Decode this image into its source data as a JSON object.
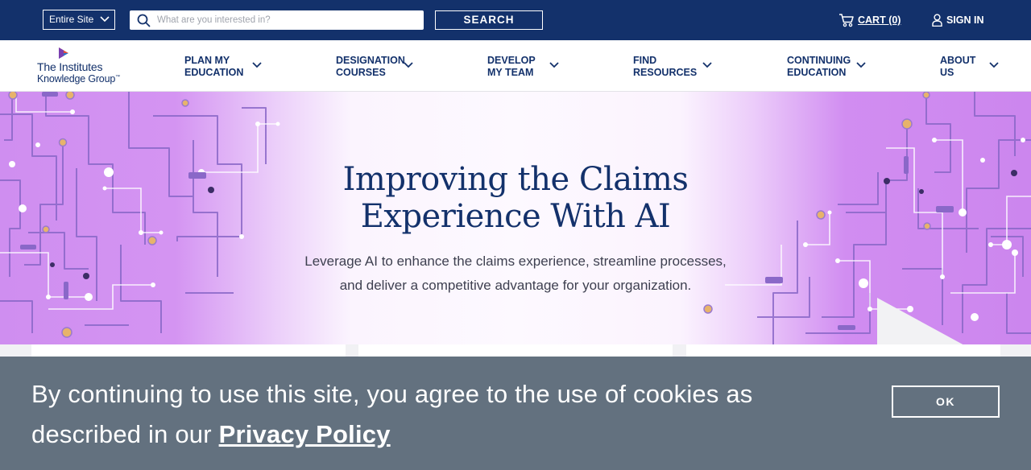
{
  "topbar": {
    "site_select": "Entire Site",
    "search_placeholder": "What are you interested in?",
    "search_button": "SEARCH",
    "cart_label": "CART (0)",
    "signin_label": "SIGN IN"
  },
  "logo": {
    "line1": "The Institutes",
    "line2": "Knowledge Group",
    "trademark": "™"
  },
  "nav": {
    "items": [
      {
        "label": "PLAN MY\nEDUCATION"
      },
      {
        "label": "DESIGNATION\nCOURSES"
      },
      {
        "label": "DEVELOP\nMY TEAM"
      },
      {
        "label": "FIND\nRESOURCES"
      },
      {
        "label": "CONTINUING\nEDUCATION"
      },
      {
        "label": "ABOUT\nUS"
      }
    ]
  },
  "hero": {
    "title": "Improving the Claims\nExperience With AI",
    "subtitle": "Leverage AI to enhance the claims experience, streamline processes,\nand deliver a competitive advantage for your organization."
  },
  "cookie": {
    "text_before": "By continuing to use this site, you agree to the use of cookies as described in our ",
    "link": "Privacy Policy",
    "ok_button": "OK"
  },
  "colors": {
    "navy": "#13316b",
    "hero_purple": "#cf8ef0",
    "cookie_gray": "#63717f",
    "circuit_line": "#8a68c8",
    "node_gold": "#e7b36b"
  },
  "icons": [
    "chevron-down-icon",
    "search-icon",
    "cart-icon",
    "user-icon",
    "logo-mark-icon"
  ]
}
